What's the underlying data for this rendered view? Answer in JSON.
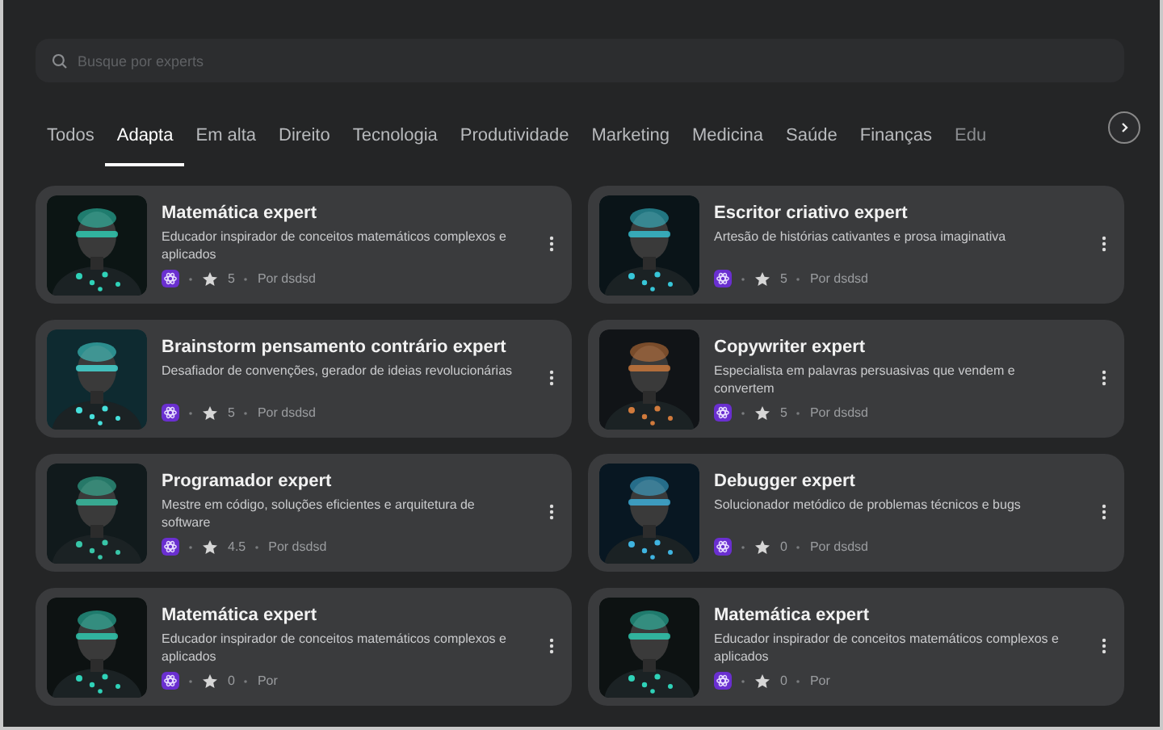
{
  "search": {
    "placeholder": "Busque por experts"
  },
  "tabs": [
    {
      "label": "Todos",
      "selected": false
    },
    {
      "label": "Adapta",
      "selected": true
    },
    {
      "label": "Em alta",
      "selected": false
    },
    {
      "label": "Direito",
      "selected": false
    },
    {
      "label": "Tecnologia",
      "selected": false
    },
    {
      "label": "Produtividade",
      "selected": false
    },
    {
      "label": "Marketing",
      "selected": false
    },
    {
      "label": "Medicina",
      "selected": false
    },
    {
      "label": "Saúde",
      "selected": false
    },
    {
      "label": "Finanças",
      "selected": false
    },
    {
      "label": "Edu",
      "selected": false
    }
  ],
  "experts": [
    {
      "title": "Matemática expert",
      "description": "Educador inspirador de conceitos matemáticos complexos e aplicados",
      "rating": "5",
      "author": "Por dsdsd"
    },
    {
      "title": "Escritor criativo expert",
      "description": "Artesão de histórias cativantes e prosa imaginativa",
      "rating": "5",
      "author": "Por dsdsd"
    },
    {
      "title": "Brainstorm pensamento contrário expert",
      "description": "Desafiador de convenções, gerador de ideias revolucionárias",
      "rating": "5",
      "author": "Por dsdsd"
    },
    {
      "title": "Copywriter expert",
      "description": "Especialista em palavras persuasivas que vendem e convertem",
      "rating": "5",
      "author": "Por dsdsd"
    },
    {
      "title": "Programador expert",
      "description": "Mestre em código, soluções eficientes e arquitetura de software",
      "rating": "4.5",
      "author": "Por dsdsd"
    },
    {
      "title": "Debugger expert",
      "description": "Solucionador metódico de problemas técnicos e bugs",
      "rating": "0",
      "author": "Por dsdsd"
    },
    {
      "title": "Matemática expert",
      "description": "Educador inspirador de conceitos matemáticos complexos e aplicados",
      "rating": "0",
      "author": "Por"
    },
    {
      "title": "Matemática expert",
      "description": "Educador inspirador de conceitos matemáticos complexos e aplicados",
      "rating": "0",
      "author": "Por"
    }
  ]
}
